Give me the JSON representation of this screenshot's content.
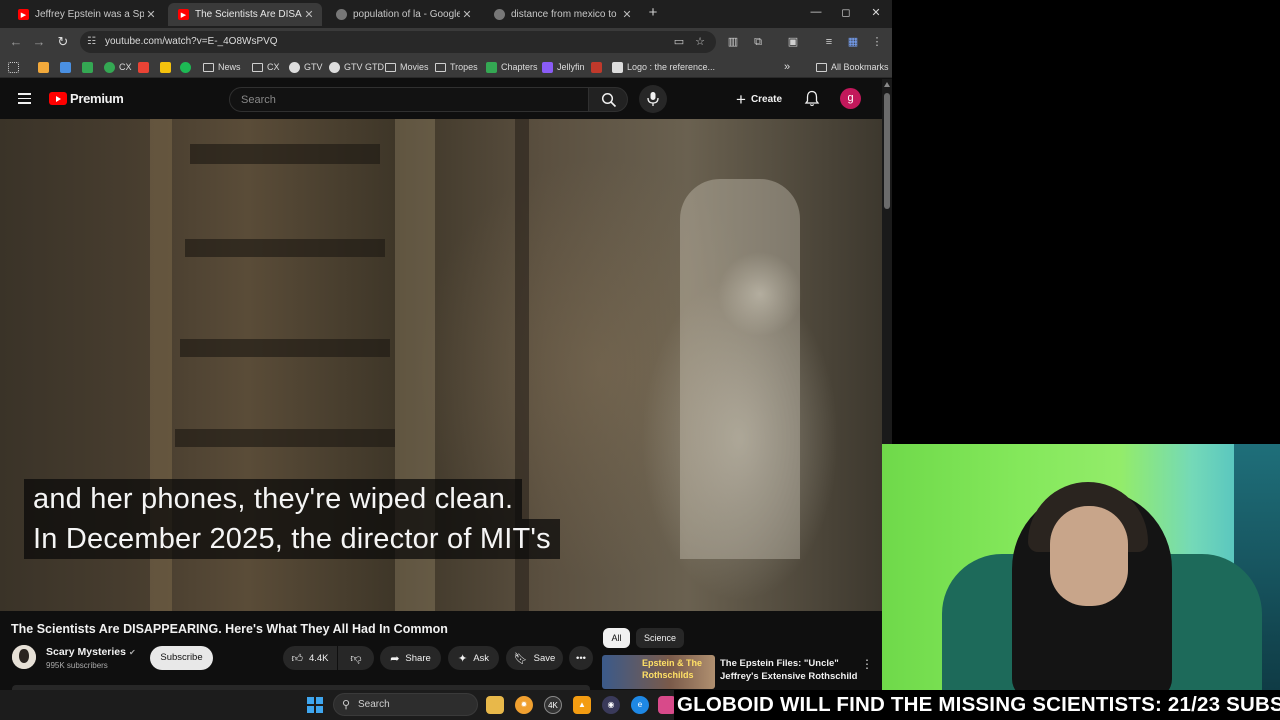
{
  "tabs": [
    {
      "title": "Jeffrey Epstein was a Spy. Here",
      "favicon": "youtube-icon",
      "active": false
    },
    {
      "title": "The Scientists Are DISAPPEARIN",
      "favicon": "youtube-icon",
      "active": true
    },
    {
      "title": "population of la - Google Searc",
      "favicon": "globe-icon",
      "active": false
    },
    {
      "title": "distance from mexico to las cru",
      "favicon": "globe-icon",
      "active": false
    }
  ],
  "address": {
    "url": "youtube.com/watch?v=E-_4O8WsPVQ"
  },
  "bookmarks": {
    "items": [
      "CX",
      "News",
      "CX",
      "GTV",
      "GTV GTD",
      "Movies",
      "Tropes",
      "Chapters",
      "Jellyfin",
      "Logo : the reference..."
    ],
    "all_label": "All Bookmarks"
  },
  "youtube": {
    "brand": "Premium",
    "search_placeholder": "Search",
    "create_label": "Create",
    "avatar_letter": "g"
  },
  "video": {
    "caption_line1": "and her phones, they're wiped clean.",
    "caption_line2": "In December 2025, the director of MIT's",
    "title": "The Scientists Are DISAPPEARING. Here's What They All Had In Common",
    "channel_name": "Scary Mysteries",
    "subscribers": "995K subscribers",
    "subscribe_label": "Subscribe",
    "likes": "4.4K",
    "share_label": "Share",
    "ask_label": "Ask",
    "save_label": "Save"
  },
  "sidebar": {
    "chips": [
      "All",
      "Science"
    ],
    "rec_thumb_text": "Epstein & The Rothschilds",
    "rec_title": "The Epstein Files: \"Uncle\" Jeffrey's Extensive Rothschild ..."
  },
  "overlay": {
    "ticker": "GLOBOID WILL FIND THE MISSING SCIENTISTS: 21/23 SUBS"
  },
  "taskbar": {
    "search_placeholder": "Search",
    "badge_4k": "4K"
  },
  "colors": {
    "youtube_red": "#ff0000",
    "avatar": "#c2185b",
    "windows_blue": "#3fa6ef"
  }
}
